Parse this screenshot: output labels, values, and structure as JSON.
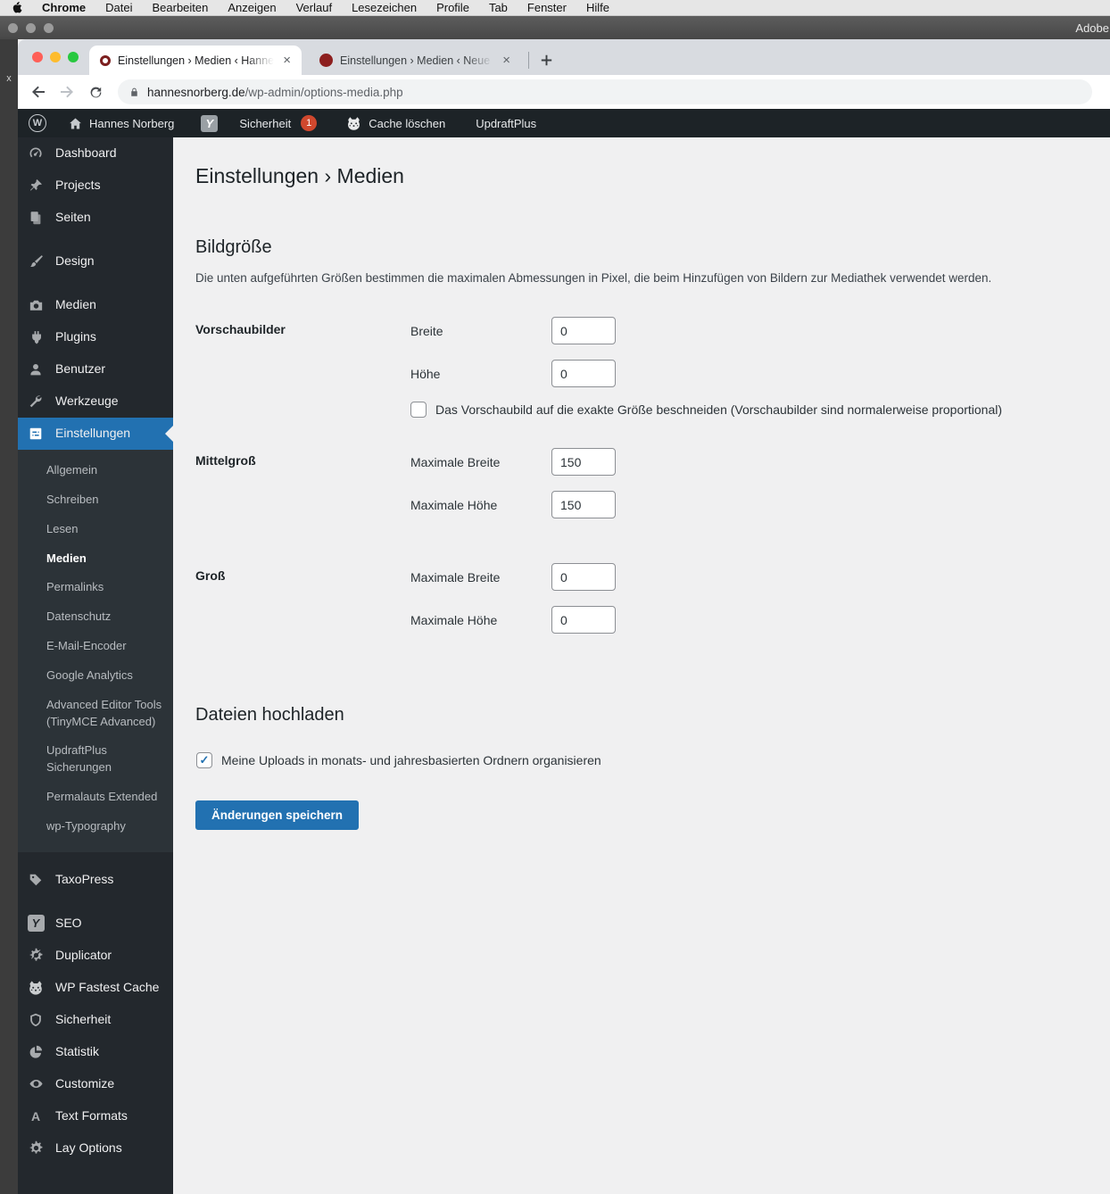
{
  "colors": {
    "accent_blue": "#2271b1",
    "adminbar_bg": "#1d2327",
    "sidebar_bg": "#23282d",
    "submenu_bg": "#2c3338",
    "content_bg": "#f0f0f1",
    "badge_orange": "#d0482e",
    "favicon_red": "#8d1f1f"
  },
  "menubar": {
    "items": [
      "Chrome",
      "Datei",
      "Bearbeiten",
      "Anzeigen",
      "Verlauf",
      "Lesezeichen",
      "Profile",
      "Tab",
      "Fenster",
      "Hilfe"
    ]
  },
  "background_window": {
    "title": "Adobe",
    "close_glyph": "x"
  },
  "browser": {
    "tabs": [
      {
        "title": "Einstellungen › Medien ‹ Hanne",
        "close": "×"
      },
      {
        "title": "Einstellungen › Medien ‹ Neue",
        "close": "×"
      }
    ],
    "url_domain": "hannesnorberg.de",
    "url_path": "/wp-admin/options-media.php"
  },
  "adminbar": {
    "wp_logo": "W",
    "site_name": "Hannes Norberg",
    "yoast": "Y",
    "security_label": "Sicherheit",
    "security_badge": "1",
    "cache_label": "Cache löschen",
    "updraft_label": "UpdraftPlus"
  },
  "sidebar": {
    "items": [
      "Dashboard",
      "Projects",
      "Seiten",
      "Design",
      "Medien",
      "Plugins",
      "Benutzer",
      "Werkzeuge",
      "Einstellungen",
      "TaxoPress",
      "SEO",
      "Duplicator",
      "WP Fastest Cache",
      "Sicherheit",
      "Statistik",
      "Customize",
      "Text Formats",
      "Lay Options"
    ],
    "submenu": [
      "Allgemein",
      "Schreiben",
      "Lesen",
      "Medien",
      "Permalinks",
      "Datenschutz",
      "E-Mail-Encoder",
      "Google Analytics",
      "Advanced Editor Tools (TinyMCE Advanced)",
      "UpdraftPlus Sicherungen",
      "Permalauts Extended",
      "wp-Typography"
    ],
    "text_formats_glyph": "A",
    "seo_glyph": "Y"
  },
  "content": {
    "page_title": "Einstellungen › Medien",
    "section_image_sizes": "Bildgröße",
    "description": "Die unten aufgeführten Größen bestimmen die maximalen Abmessungen in Pixel, die beim Hinzufügen von Bildern zur Mediathek verwendet werden.",
    "rows": [
      {
        "label": "Vorschaubilder",
        "fields": [
          {
            "label": "Breite",
            "value": "0"
          },
          {
            "label": "Höhe",
            "value": "0"
          }
        ],
        "checkbox": {
          "label": "Das Vorschaubild auf die exakte Größe beschneiden (Vorschaubilder sind normalerweise proportional)",
          "checked": false
        }
      },
      {
        "label": "Mittelgroß",
        "fields": [
          {
            "label": "Maximale Breite",
            "value": "150"
          },
          {
            "label": "Maximale Höhe",
            "value": "150"
          }
        ]
      },
      {
        "label": "Groß",
        "fields": [
          {
            "label": "Maximale Breite",
            "value": "0"
          },
          {
            "label": "Maximale Höhe",
            "value": "0"
          }
        ]
      }
    ],
    "section_uploads": "Dateien hochladen",
    "upload_checkbox": {
      "label": "Meine Uploads in monats- und jahresbasierten Ordnern organisieren",
      "checked": true
    },
    "save_button": "Änderungen speichern"
  }
}
